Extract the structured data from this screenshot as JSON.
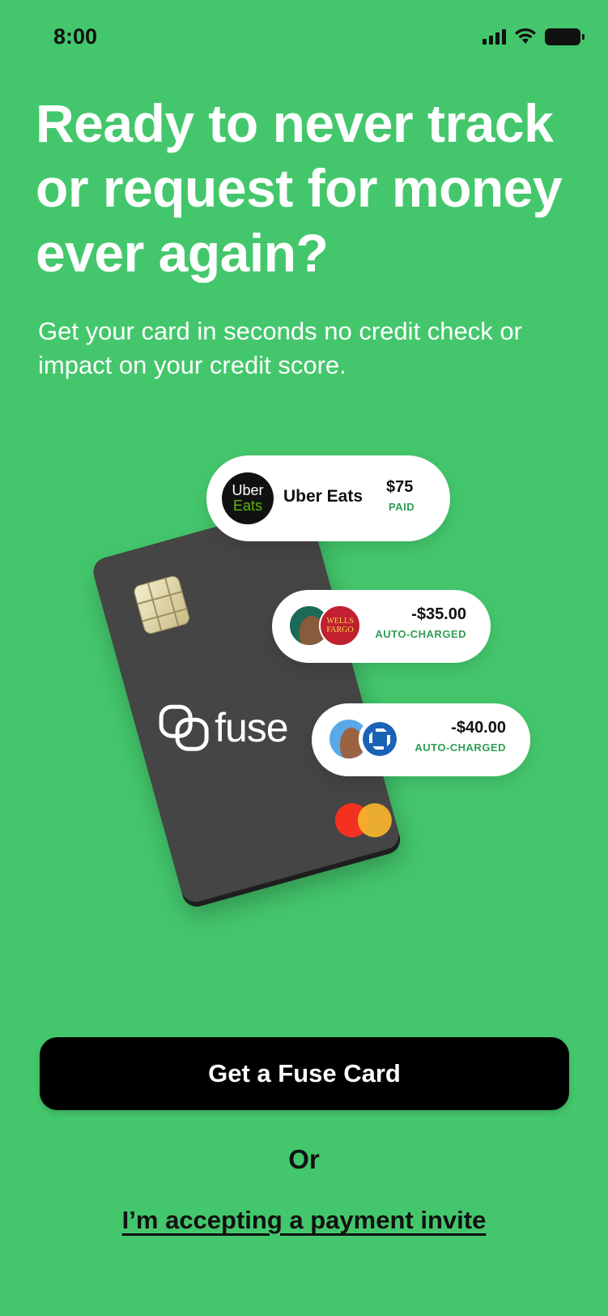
{
  "status_bar": {
    "time": "8:00",
    "icons": [
      "signal-icon",
      "wifi-icon",
      "battery-icon"
    ]
  },
  "headline": "Ready to never track or request for money ever again?",
  "subheadline": "Get your card in seconds no credit check or impact on your credit score.",
  "card": {
    "brand": "fuse",
    "network_icon": "mastercard-logo-icon"
  },
  "transactions": [
    {
      "merchant": "Uber Eats",
      "logo_line1": "Uber",
      "logo_line2": "Eats",
      "amount": "$75",
      "status": "PAID"
    },
    {
      "amount": "-$35.00",
      "status": "AUTO-CHARGED",
      "bank_logo_line1": "WELLS",
      "bank_logo_line2": "FARGO"
    },
    {
      "amount": "-$40.00",
      "status": "AUTO-CHARGED",
      "bank_icon": "chase-logo-icon"
    }
  ],
  "cta_label": "Get a Fuse Card",
  "or_label": "Or",
  "invite_link": "I’m accepting a payment invite",
  "colors": {
    "background": "#44c76c",
    "status_green": "#2f9e55",
    "cta": "#000000"
  }
}
